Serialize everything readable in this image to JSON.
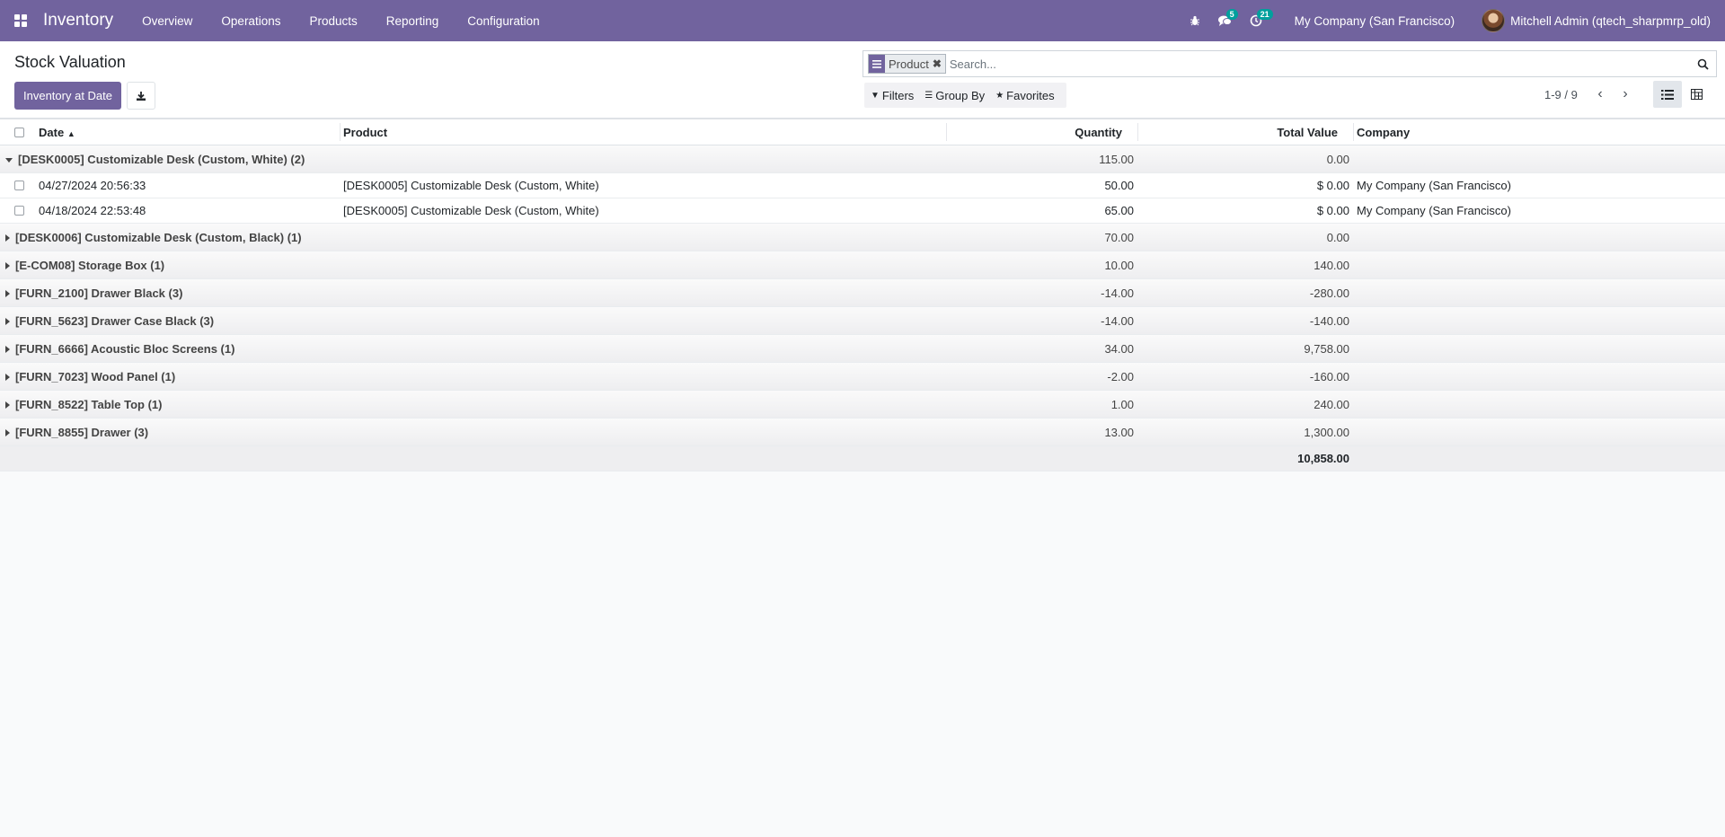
{
  "navbar": {
    "app_name": "Inventory",
    "menu": [
      "Overview",
      "Operations",
      "Products",
      "Reporting",
      "Configuration"
    ],
    "messages_badge": "5",
    "activities_badge": "21",
    "company": "My Company (San Francisco)",
    "user": "Mitchell Admin (qtech_sharpmrp_old)"
  },
  "control": {
    "title": "Stock Valuation",
    "primary_button": "Inventory at Date",
    "facet_value": "Product",
    "search_placeholder": "Search...",
    "filters_label": "Filters",
    "groupby_label": "Group By",
    "favorites_label": "Favorites",
    "pager": "1-9 / 9"
  },
  "table": {
    "headers": {
      "date": "Date",
      "product": "Product",
      "quantity": "Quantity",
      "total_value": "Total Value",
      "company": "Company"
    },
    "groups": [
      {
        "label": "[DESK0005] Customizable Desk (Custom, White) (2)",
        "quantity": "115.00",
        "value": "0.00",
        "expanded": true,
        "rows": [
          {
            "date": "04/27/2024 20:56:33",
            "product": "[DESK0005] Customizable Desk (Custom, White)",
            "quantity": "50.00",
            "value": "$ 0.00",
            "company": "My Company (San Francisco)"
          },
          {
            "date": "04/18/2024 22:53:48",
            "product": "[DESK0005] Customizable Desk (Custom, White)",
            "quantity": "65.00",
            "value": "$ 0.00",
            "company": "My Company (San Francisco)"
          }
        ]
      },
      {
        "label": "[DESK0006] Customizable Desk (Custom, Black) (1)",
        "quantity": "70.00",
        "value": "0.00"
      },
      {
        "label": "[E-COM08] Storage Box (1)",
        "quantity": "10.00",
        "value": "140.00"
      },
      {
        "label": "[FURN_2100] Drawer Black (3)",
        "quantity": "-14.00",
        "value": "-280.00"
      },
      {
        "label": "[FURN_5623] Drawer Case Black (3)",
        "quantity": "-14.00",
        "value": "-140.00"
      },
      {
        "label": "[FURN_6666] Acoustic Bloc Screens (1)",
        "quantity": "34.00",
        "value": "9,758.00"
      },
      {
        "label": "[FURN_7023] Wood Panel (1)",
        "quantity": "-2.00",
        "value": "-160.00"
      },
      {
        "label": "[FURN_8522] Table Top (1)",
        "quantity": "1.00",
        "value": "240.00"
      },
      {
        "label": "[FURN_8855] Drawer (3)",
        "quantity": "13.00",
        "value": "1,300.00"
      }
    ],
    "total_value": "10,858.00"
  }
}
